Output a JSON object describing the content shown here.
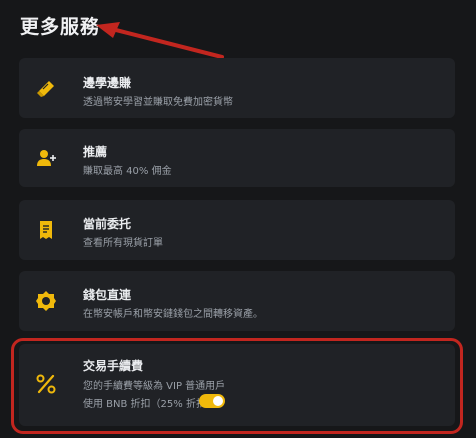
{
  "header": {
    "title": "更多服務"
  },
  "cards": [
    {
      "title": "邊學邊賺",
      "subtitle": "透過幣安學習並賺取免費加密貨幣",
      "icon": "graduation-book-icon"
    },
    {
      "title": "推薦",
      "subtitle": "賺取最高 40% 佣金",
      "icon": "add-user-icon"
    },
    {
      "title": "當前委托",
      "subtitle": "查看所有現貨訂單",
      "icon": "receipt-icon"
    },
    {
      "title": "錢包直連",
      "subtitle": "在幣安帳戶和幣安鏈錢包之間轉移資產。",
      "icon": "gear-icon"
    },
    {
      "title": "交易手續費",
      "subtitle": "您的手續費等級為 VIP 普通用戶",
      "subtitle2": "使用 BNB 折扣（25% 折扣）",
      "icon": "percent-icon",
      "toggle_on": true
    }
  ],
  "colors": {
    "accent": "#f0b90b",
    "highlight": "#c2261f",
    "card": "#202226",
    "background": "#161719"
  }
}
